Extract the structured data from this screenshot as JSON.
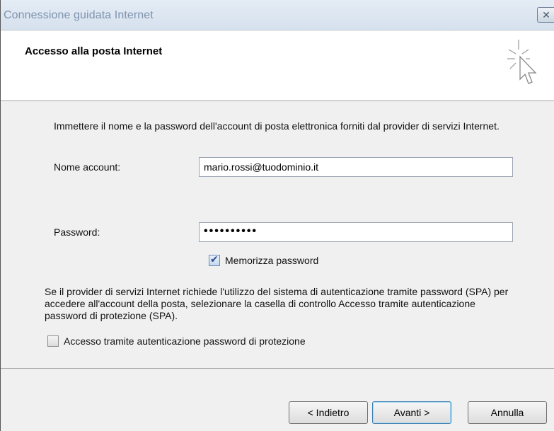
{
  "window": {
    "title": "Connessione guidata Internet",
    "close_glyph": "✕"
  },
  "header": {
    "heading": "Accesso alla posta Internet",
    "icon": "wizard-cursor-icon"
  },
  "form": {
    "intro": "Immettere il nome e la password dell'account di posta elettronica forniti dal provider di servizi Internet.",
    "account_label": "Nome account:",
    "account_value": "mario.rossi@tuodominio.it",
    "password_label": "Password:",
    "password_value": "••••••••••",
    "remember_label": "Memorizza password",
    "remember_checked": true,
    "spa_info": "Se il provider di servizi Internet richiede l'utilizzo del sistema di autenticazione tramite password (SPA) per accedere all'account della posta, selezionare la casella di controllo Accesso tramite autenticazione password di protezione (SPA).",
    "spa_label": "Accesso tramite autenticazione password di protezione",
    "spa_checked": false
  },
  "buttons": {
    "back": "< Indietro",
    "next": "Avanti >",
    "cancel": "Annulla"
  }
}
